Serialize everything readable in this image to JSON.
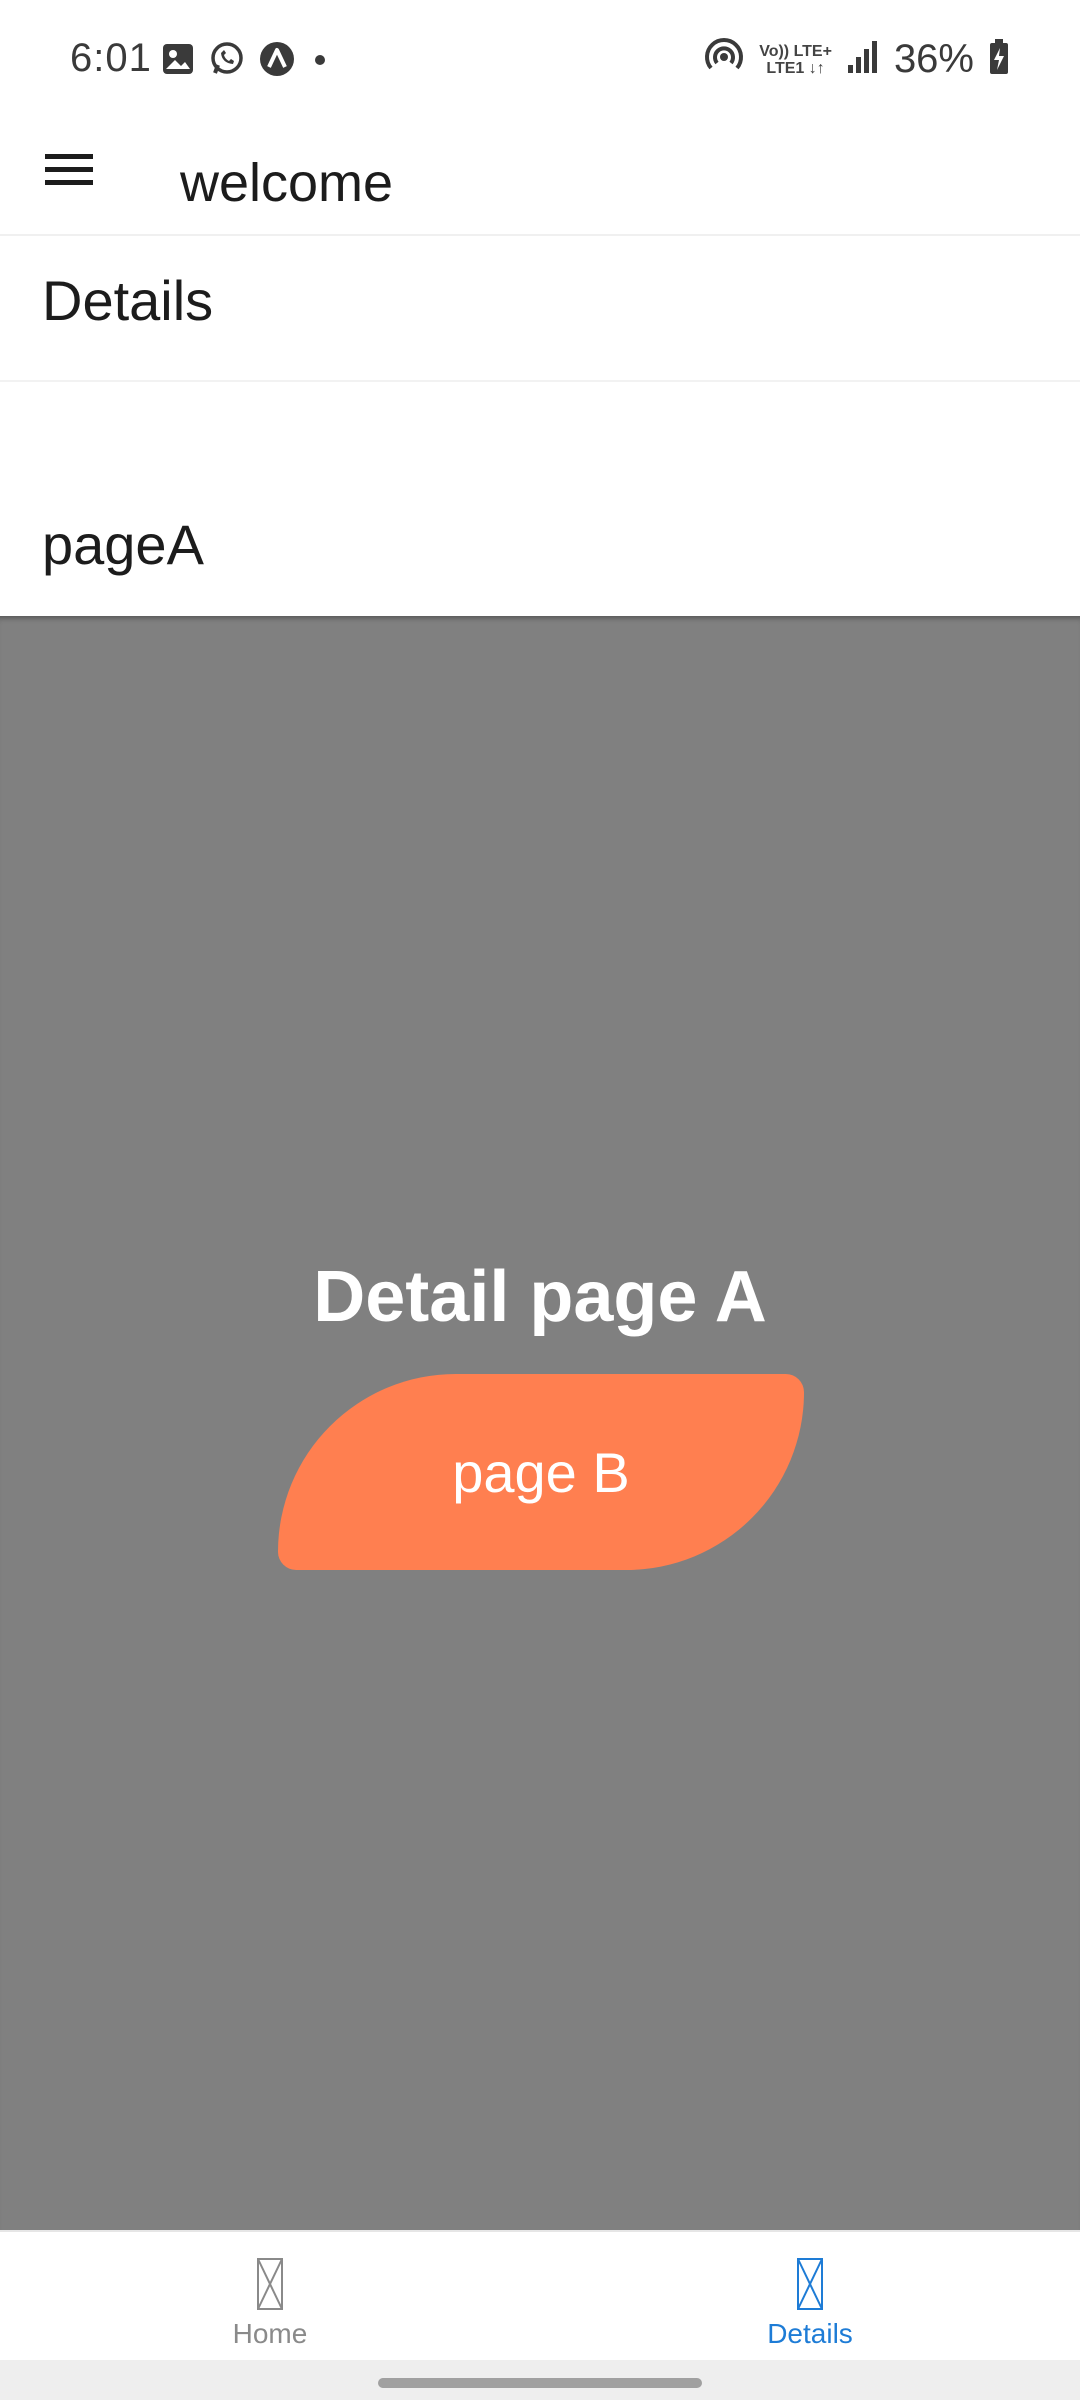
{
  "status_bar": {
    "time": "6:01",
    "battery_percent": "36%",
    "lte_top": "Vo)) LTE+",
    "lte_bottom": "LTE1 ↓↑",
    "left_icons": [
      "gallery-icon",
      "whatsapp-icon",
      "app-a-icon",
      "dot-icon"
    ],
    "right_icons": [
      "hotspot-icon",
      "volte-icon",
      "signal-icon",
      "battery-charging-icon"
    ]
  },
  "app_bar": {
    "title": "welcome",
    "menu_icon": "hamburger-menu-icon"
  },
  "section": {
    "title": "Details"
  },
  "page": {
    "title": "pageA"
  },
  "content": {
    "heading": "Detail page A",
    "button_label": "page B",
    "background_color": "#808080",
    "button_color": "#ff7f50"
  },
  "bottom_nav": {
    "items": [
      {
        "label": "Home",
        "icon": "placeholder-icon",
        "active": false
      },
      {
        "label": "Details",
        "icon": "placeholder-icon",
        "active": true
      }
    ],
    "active_color": "#1e7cd6",
    "inactive_color": "#8a8a8a"
  }
}
